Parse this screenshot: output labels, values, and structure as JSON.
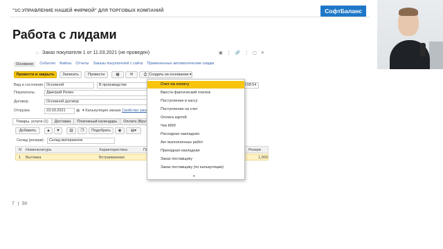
{
  "slide": {
    "caption": "\"1С:УПРАВЛЕНИЕ НАШЕЙ ФИРМОЙ\" ДЛЯ ТОРГОВЫХ КОМПАНИЙ",
    "logo": "СофтБаланс",
    "title": "Работа с лидами",
    "page_current": "7",
    "page_sep": "|",
    "page_total": "50"
  },
  "window": {
    "title": "Заказ покупателя 1 от 11.03.2021 (не проведен)",
    "star": "☆",
    "title_icons": [
      "▣",
      "⋮",
      "🔗",
      "⋮",
      "▢",
      "✕"
    ],
    "tabs": [
      "Основное",
      "События",
      "Файлы",
      "Отчеты",
      "Заказы покупателей с сайта",
      "Примененные автоматические скидки"
    ],
    "toolbar": {
      "post_close": "Провести и закрыть",
      "save": "Записать",
      "post": "Провести",
      "create_basis": "Создать на основании ▾"
    },
    "form": {
      "type_state_label": "Вид и состояние:",
      "type_value": "Основной",
      "state_value": "В производстве",
      "customer_label": "Покупатель:",
      "customer_value": "Дмитрий Репин",
      "contract_label": "Договор",
      "contract_value": "Основной договор",
      "shipment_label": "Отгрузка",
      "shipment_date": "23.03.2021",
      "calc_label": "▾ Калькуляция заказа",
      "calc_link": "Свойство заказ",
      "time_value": "19:08:54"
    },
    "subtabs": [
      "Товары, услуги (1)",
      "Доставка",
      "Платежный календарь",
      "Оплата (Вручную)"
    ],
    "grid_toolbar": {
      "add": "Добавить",
      "pick": "Подобрать"
    },
    "warehouse_label": "Склад (резерв):",
    "warehouse_value": "Склад материалов",
    "table": {
      "headers": [
        "N",
        "Номенклатура",
        "Характеристика",
        "Па",
        "Резерв"
      ],
      "rows": [
        {
          "n": "1",
          "item": "Вытяжка",
          "variant": "Встраиваемая",
          "amount": "1,000"
        }
      ]
    }
  },
  "dropdown": {
    "items": [
      "Счет на оплату",
      "Ввести фактический платеж",
      "Поступление в кассу",
      "Поступление на счет",
      "Оплата картой",
      "Чек ККМ",
      "Расходная накладная",
      "Акт выполненных работ",
      "Приходная накладная",
      "Заказ поставщику",
      "Заказ поставщику (по калькуляции)"
    ],
    "scroll_arrow": "▾"
  },
  "colors": {
    "accent": "#f7c50f",
    "link": "#3a68b0",
    "brand": "#1e78c8"
  }
}
